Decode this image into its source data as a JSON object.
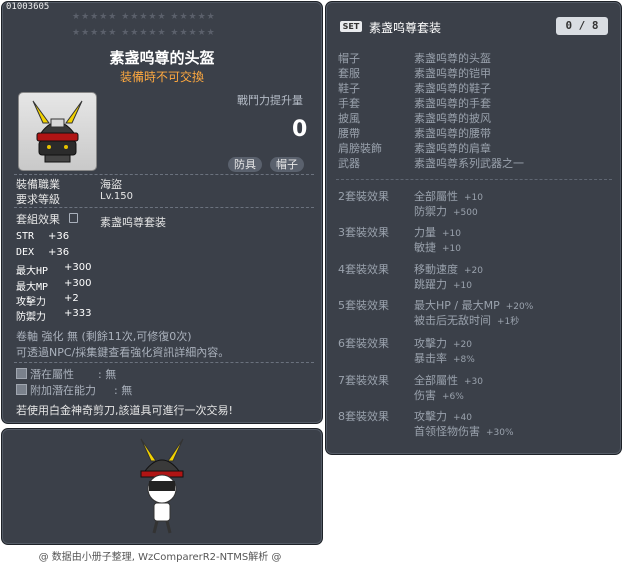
{
  "item": {
    "id": "01003605",
    "name": "素盏呜尊的头盔",
    "trade_note": "装備時不可交換",
    "power_label": "戰鬥力提升量",
    "power_value": "0",
    "tags": [
      "防具",
      "帽子"
    ],
    "job_label": "裝備職業",
    "job_value": "海盜",
    "level_label": "要求等級",
    "level_value": "Lv.150",
    "set_label": "套組效果",
    "set_value": "素盏呜尊套装",
    "stats": [
      {
        "label": "STR",
        "value": "+36"
      },
      {
        "label": "DEX",
        "value": "+36"
      },
      {
        "label": "最大HP",
        "value": "+300"
      },
      {
        "label": "最大MP",
        "value": "+300"
      },
      {
        "label": "攻擊力",
        "value": "+2"
      },
      {
        "label": "防禦力",
        "value": "+333"
      }
    ],
    "upgrade_line": "卷軸 強化 無 (剩餘11次,可修復0次)",
    "npc_line": "可透過NPC/採集鍵查看強化資訊詳細內容。",
    "potential_label": "潛在屬性",
    "potential_value": ": 無",
    "bonus_potential_label": "附加潛在能力",
    "bonus_potential_value": ": 無",
    "scissors_note": "若使用白金神奇剪刀,該道具可進行一次交易!"
  },
  "set": {
    "badge": "SET",
    "name": "素盏呜尊套装",
    "count": "0 / 8",
    "parts": [
      {
        "label": "帽子",
        "item": "素盏呜尊的头盔"
      },
      {
        "label": "套服",
        "item": "素盏呜尊的铠甲"
      },
      {
        "label": "鞋子",
        "item": "素盏呜尊的鞋子"
      },
      {
        "label": "手套",
        "item": "素盏呜尊的手套"
      },
      {
        "label": "披風",
        "item": "素盏呜尊的披风"
      },
      {
        "label": "腰帶",
        "item": "素盏呜尊的腰带"
      },
      {
        "label": "肩膀裝飾",
        "item": "素盏呜尊的肩章"
      },
      {
        "label": "武器",
        "item": "素盏呜尊系列武器之一"
      }
    ],
    "effects": [
      {
        "label": "2套裝效果",
        "lines": [
          [
            "全部屬性",
            "+10"
          ],
          [
            "防禦力",
            "+500"
          ]
        ]
      },
      {
        "label": "3套裝效果",
        "lines": [
          [
            "力量",
            "+10"
          ],
          [
            "敏捷",
            "+10"
          ]
        ]
      },
      {
        "label": "4套裝效果",
        "lines": [
          [
            "移動速度",
            "+20"
          ],
          [
            "跳躍力",
            "+10"
          ]
        ]
      },
      {
        "label": "5套裝效果",
        "lines": [
          [
            "最大HP / 最大MP",
            "+20%"
          ],
          [
            "被击后无敌时间",
            "+1秒"
          ]
        ]
      },
      {
        "label": "6套裝效果",
        "lines": [
          [
            "攻擊力",
            "+20"
          ],
          [
            "暴击率",
            "+8%"
          ]
        ]
      },
      {
        "label": "7套裝效果",
        "lines": [
          [
            "全部屬性",
            "+30"
          ],
          [
            "伤害",
            "+6%"
          ]
        ]
      },
      {
        "label": "8套裝效果",
        "lines": [
          [
            "攻擊力",
            "+40"
          ],
          [
            "首领怪物伤害",
            "+30%"
          ]
        ]
      }
    ]
  },
  "footer": "@ 数据由小册子整理, WzComparerR2-NTMS解析 @",
  "icons": [
    "helmet-icon",
    "character-preview",
    "set-badge-icon",
    "potential-icon",
    "lock-icon"
  ],
  "colors": {
    "panel": "#3b4049",
    "trade_note": "#ffa93f",
    "muted": "#9aa2ad"
  }
}
